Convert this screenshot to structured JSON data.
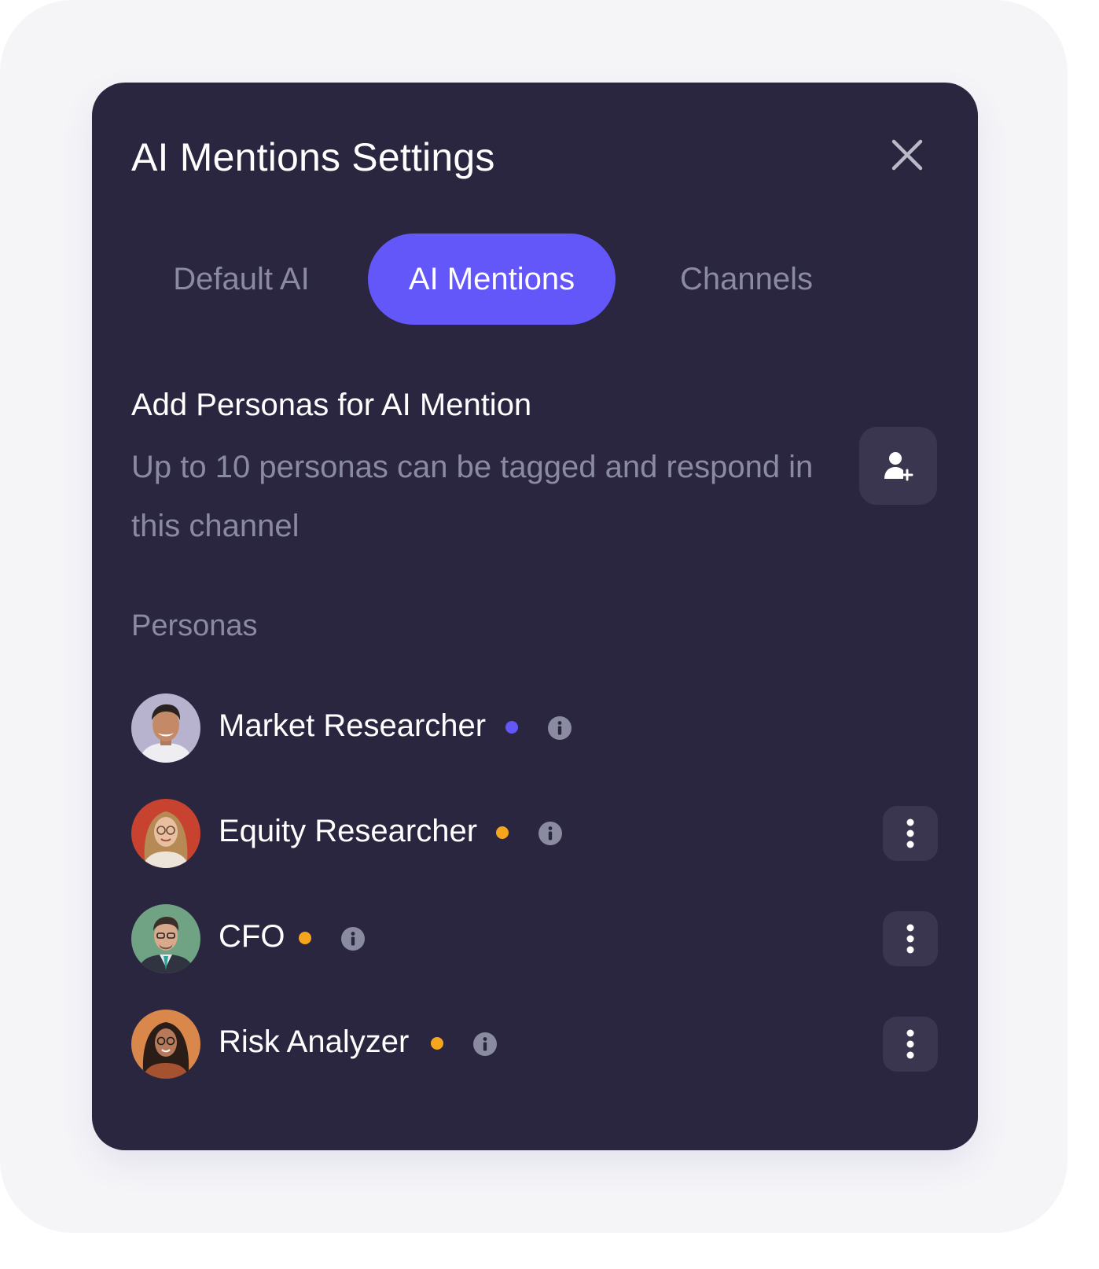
{
  "dialog": {
    "title": "AI Mentions Settings",
    "close_icon": "close-icon"
  },
  "tabs": [
    {
      "label": "Default AI",
      "active": false
    },
    {
      "label": "AI Mentions",
      "active": true
    },
    {
      "label": "Channels",
      "active": false
    }
  ],
  "add_section": {
    "heading": "Add Personas for AI Mention",
    "description": "Up to 10 personas can be tagged and respond in this channel",
    "add_icon": "add-user-icon"
  },
  "personas_label": "Personas",
  "personas": [
    {
      "name": "Market Researcher",
      "status_color": "#6457fa",
      "has_menu": false
    },
    {
      "name": "Equity Researcher",
      "status_color": "#f6a61c",
      "has_menu": true
    },
    {
      "name": "CFO",
      "status_color": "#f6a61c",
      "has_menu": true
    },
    {
      "name": "Risk Analyzer",
      "status_color": "#f6a61c",
      "has_menu": true
    }
  ],
  "colors": {
    "accent": "#6457fa",
    "card_bg": "#2a2640",
    "button_bg": "#3a3650",
    "muted_text": "#8a8aa0",
    "status_orange": "#f6a61c"
  }
}
